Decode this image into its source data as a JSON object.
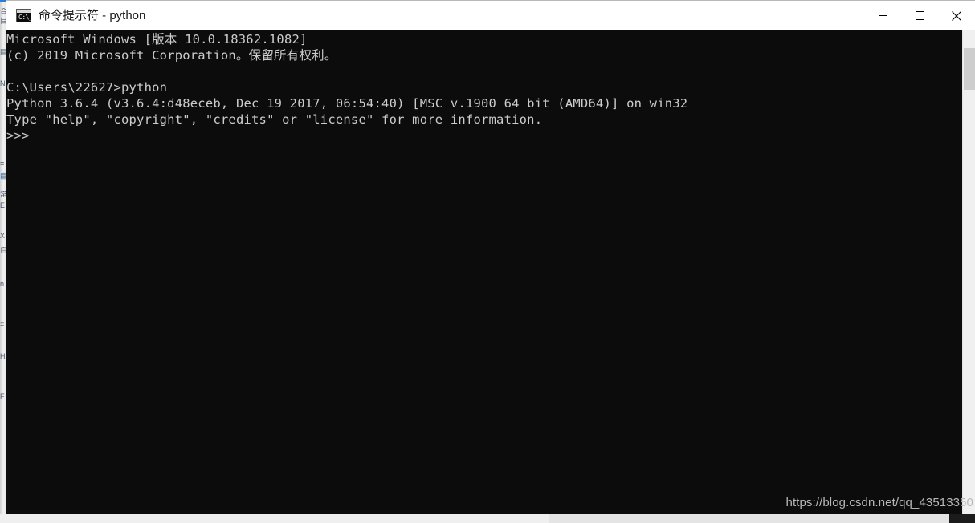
{
  "window": {
    "title": "命令提示符 - python",
    "icon": "cmd-icon",
    "icon_text": "C:\\_",
    "controls": {
      "minimize": "—",
      "maximize": "□",
      "close": "✕"
    }
  },
  "console": {
    "lines": [
      "Microsoft Windows [版本 10.0.18362.1082]",
      "(c) 2019 Microsoft Corporation。保留所有权利。",
      "",
      "C:\\Users\\22627>python",
      "Python 3.6.4 (v3.6.4:d48eceb, Dec 19 2017, 06:54:40) [MSC v.1900 64 bit (AMD64)] on win32",
      "Type \"help\", \"copyright\", \"credits\" or \"license\" for more information.",
      ">>>"
    ],
    "text": "Microsoft Windows [版本 10.0.18362.1082]\n(c) 2019 Microsoft Corporation。保留所有权利。\n\nC:\\Users\\22627>python\nPython 3.6.4 (v3.6.4:d48eceb, Dec 19 2017, 06:54:40) [MSC v.1900 64 bit (AMD64)] on win32\nType \"help\", \"copyright\", \"credits\" or \"license\" for more information.\n>>>",
    "prompt": ">>>",
    "background_color": "#0c0c0c",
    "text_color": "#cccccc"
  },
  "watermark": {
    "text": "https://blog.csdn.net/qq_43513350"
  },
  "background_window": {
    "rows": [
      "合",
      "t",
      "",
      "",
      "",
      "",
      "",
      "",
      "",
      "",
      "",
      "",
      "",
      ""
    ]
  }
}
